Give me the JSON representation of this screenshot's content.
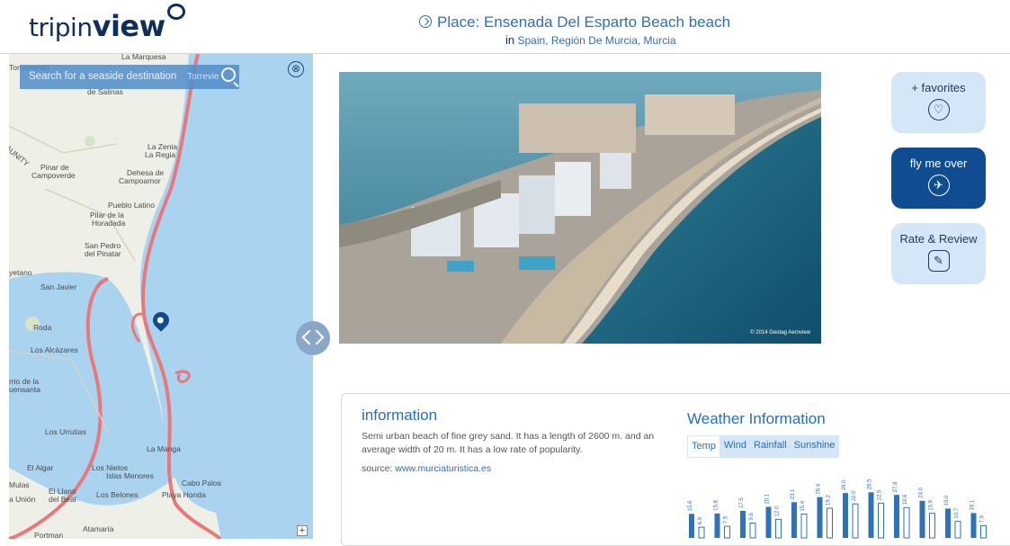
{
  "header": {
    "logo_prefix": "tripin",
    "logo_bold": "view",
    "place_title": "Place: Ensenada Del Esparto Beach beach",
    "place_in": "in",
    "place_location": "Spain, Región De Murcia, Murcia"
  },
  "map": {
    "search_placeholder": "Search for a seaside destination",
    "search_overlap_label": "Torrevie",
    "zoom_in": "+",
    "close": "⊗",
    "labels": [
      "Torremendo",
      "La Marquesa",
      "de Salinas",
      "La Zenia",
      "La Regia",
      "Pinar de",
      "Campoverde",
      "Dehesa de",
      "Campoamor",
      "Pueblo Latino",
      "Pilar de la",
      "Horadada",
      "San Pedro",
      "del Pinatar",
      "yetano",
      "San Javier",
      "Roda",
      "Los Alcázares",
      "Los Urrutias",
      "La Manga",
      "Los Nietos",
      "Islas Menores",
      "El Algar",
      "El Llano",
      "del Beal",
      "Los Belones",
      "Cabo Palos",
      "Playa Honda",
      "Atamaría",
      "Portman",
      "Mulas",
      "a Unión",
      "rrio de la",
      "uensanta",
      "AUNITY"
    ]
  },
  "photo": {
    "credit": "© 2014 Geotag Aeroview"
  },
  "actions": {
    "favorites_label": "+ favorites",
    "fly_label": "fly me over",
    "rate_label": "Rate & Review"
  },
  "info": {
    "title": "information",
    "text": "Semi urban beach of fine grey sand. It has a length of 2600 m. and an average width of 20 m. It has a low rate of popularity.",
    "source_label": "source:",
    "source_link": "www.murciaturistica.es"
  },
  "weather": {
    "title": "Weather Information",
    "tabs": [
      "Temp",
      "Wind",
      "Rainfall",
      "Sunshine"
    ],
    "active_tab": "Temp"
  },
  "chart_data": {
    "type": "bar",
    "title": "",
    "categories": [
      "",
      "",
      "",
      "",
      "",
      "",
      "",
      "",
      "",
      "",
      "",
      ""
    ],
    "series": [
      {
        "values": [
          15.6,
          15.8,
          17.5,
          20.1,
          23.1,
          26.4,
          29.0,
          29.5,
          27.8,
          24.0,
          19.0,
          16.1
        ]
      },
      {
        "values": [
          6.9,
          7.5,
          9.6,
          12.0,
          15.4,
          19.2,
          22.0,
          22.5,
          19.6,
          15.9,
          10.7,
          7.9
        ]
      }
    ],
    "ylim": [
      0,
      32
    ],
    "colors": {
      "high": "#2f72b8",
      "low": "#ffffff",
      "low_stroke": "#2f72b8"
    }
  }
}
